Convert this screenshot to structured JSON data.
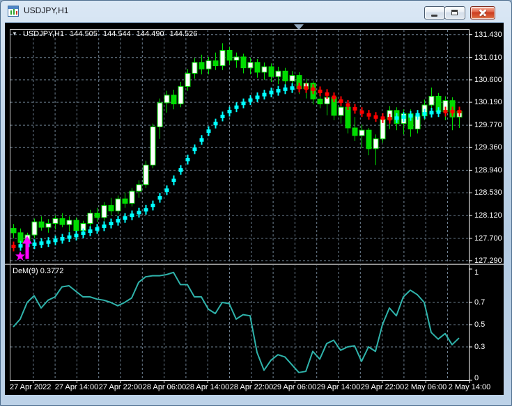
{
  "window": {
    "title": "USDJPY,H1",
    "controls": {
      "minimize": "minimize",
      "restore": "restore",
      "close": "close"
    }
  },
  "chart": {
    "header": {
      "symbol_period": "USDJPY,H1",
      "open": "144.505",
      "high": "144.544",
      "low": "144.490",
      "close": "144.526"
    },
    "price_axis_labels": [
      "131.430",
      "131.010",
      "130.600",
      "130.190",
      "129.770",
      "129.360",
      "128.940",
      "128.530",
      "128.120",
      "127.700",
      "127.290"
    ],
    "time_axis_labels": [
      "27 Apr 2022",
      "27 Apr 14:00",
      "27 Apr 22:00",
      "28 Apr 06:00",
      "28 Apr 14:00",
      "28 Apr 22:00",
      "29 Apr 06:00",
      "29 Apr 14:00",
      "29 Apr 22:00",
      "2 May 06:00",
      "2 May 14:00"
    ],
    "indicator": {
      "label": "DeM(9) 0.3772",
      "name": "DeMarker",
      "axis_labels": [
        "1",
        "0.7",
        "0.5",
        "0.3",
        "0"
      ],
      "levels": [
        0.7,
        0.5,
        0.3
      ]
    },
    "colors": {
      "background": "#000000",
      "grid": "#6e8091",
      "candle": "#00dc00",
      "bull_body": "#ffffff",
      "ma_up": "#00ffff",
      "ma_down": "#ff0000",
      "dem_line": "#2fb3ab",
      "signal": "#ff00ff",
      "axis_text": "#ffffff",
      "border": "#c8c8c8"
    },
    "chart_data": {
      "type": "candlestick",
      "symbol": "USDJPY",
      "period": "H1",
      "price_range": [
        127.29,
        131.43
      ],
      "dem_range": [
        0,
        1
      ],
      "candles": [
        [
          127.88,
          127.96,
          127.7,
          127.8
        ],
        [
          127.8,
          127.88,
          127.52,
          127.62
        ],
        [
          127.62,
          127.8,
          127.44,
          127.76
        ],
        [
          127.76,
          128.06,
          127.7,
          128.0
        ],
        [
          128.0,
          128.1,
          127.84,
          127.9
        ],
        [
          127.9,
          128.05,
          127.8,
          127.97
        ],
        [
          127.97,
          128.12,
          127.86,
          128.06
        ],
        [
          128.06,
          128.16,
          127.9,
          127.95
        ],
        [
          127.95,
          128.1,
          127.82,
          128.03
        ],
        [
          128.03,
          128.08,
          127.72,
          127.84
        ],
        [
          127.84,
          128.02,
          127.72,
          127.97
        ],
        [
          127.97,
          128.22,
          127.9,
          128.16
        ],
        [
          128.16,
          128.26,
          128.0,
          128.08
        ],
        [
          128.08,
          128.36,
          128.02,
          128.3
        ],
        [
          128.3,
          128.44,
          128.12,
          128.2
        ],
        [
          128.2,
          128.48,
          128.14,
          128.42
        ],
        [
          128.42,
          128.54,
          128.26,
          128.34
        ],
        [
          128.34,
          128.62,
          128.28,
          128.56
        ],
        [
          128.56,
          128.76,
          128.44,
          128.68
        ],
        [
          128.68,
          129.12,
          128.62,
          129.04
        ],
        [
          129.04,
          129.8,
          128.98,
          129.74
        ],
        [
          129.74,
          130.26,
          129.52,
          130.18
        ],
        [
          130.18,
          130.4,
          130.0,
          130.32
        ],
        [
          130.32,
          130.42,
          130.06,
          130.16
        ],
        [
          130.16,
          130.56,
          130.1,
          130.48
        ],
        [
          130.48,
          130.8,
          130.4,
          130.72
        ],
        [
          130.72,
          131.0,
          130.62,
          130.92
        ],
        [
          130.92,
          131.06,
          130.7,
          130.8
        ],
        [
          130.8,
          131.02,
          130.7,
          130.95
        ],
        [
          130.95,
          131.1,
          130.78,
          130.86
        ],
        [
          130.86,
          131.27,
          130.78,
          131.14
        ],
        [
          131.14,
          131.2,
          130.88,
          130.96
        ],
        [
          130.96,
          131.1,
          130.82,
          131.02
        ],
        [
          131.02,
          131.08,
          130.72,
          130.82
        ],
        [
          130.82,
          131.0,
          130.7,
          130.92
        ],
        [
          130.92,
          130.98,
          130.64,
          130.74
        ],
        [
          130.74,
          130.92,
          130.6,
          130.84
        ],
        [
          130.84,
          130.9,
          130.56,
          130.66
        ],
        [
          130.66,
          130.84,
          130.52,
          130.76
        ],
        [
          130.76,
          130.82,
          130.48,
          130.58
        ],
        [
          130.58,
          130.76,
          130.4,
          130.68
        ],
        [
          130.68,
          130.74,
          130.34,
          130.44
        ],
        [
          130.44,
          130.62,
          130.26,
          130.54
        ],
        [
          130.54,
          130.58,
          130.15,
          130.25
        ],
        [
          130.25,
          130.45,
          130.08,
          130.16
        ],
        [
          130.16,
          130.35,
          129.95,
          130.28
        ],
        [
          130.28,
          130.32,
          129.86,
          129.95
        ],
        [
          129.95,
          130.18,
          129.8,
          130.1
        ],
        [
          130.1,
          130.14,
          129.62,
          129.72
        ],
        [
          129.72,
          129.92,
          129.48,
          129.58
        ],
        [
          129.58,
          129.78,
          129.35,
          129.68
        ],
        [
          129.68,
          129.72,
          129.22,
          129.34
        ],
        [
          129.34,
          129.6,
          129.04,
          129.52
        ],
        [
          129.52,
          129.95,
          129.45,
          129.88
        ],
        [
          129.88,
          130.12,
          129.7,
          130.04
        ],
        [
          130.04,
          130.1,
          129.68,
          129.8
        ],
        [
          129.8,
          130.06,
          129.6,
          129.98
        ],
        [
          129.98,
          130.06,
          129.56,
          129.7
        ],
        [
          129.7,
          130.02,
          129.62,
          129.94
        ],
        [
          129.94,
          130.24,
          129.86,
          130.14
        ],
        [
          130.14,
          130.46,
          130.04,
          130.3
        ],
        [
          130.3,
          130.36,
          129.92,
          130.02
        ],
        [
          130.02,
          130.3,
          129.86,
          130.22
        ],
        [
          130.22,
          130.28,
          129.68,
          129.92
        ],
        [
          129.92,
          130.1,
          129.72,
          130.02
        ]
      ],
      "ma": {
        "values": [
          127.55,
          127.56,
          127.57,
          127.59,
          127.61,
          127.63,
          127.66,
          127.69,
          127.72,
          127.75,
          127.79,
          127.83,
          127.87,
          127.92,
          127.97,
          128.02,
          128.07,
          128.12,
          128.17,
          128.22,
          128.3,
          128.44,
          128.58,
          128.76,
          128.95,
          129.14,
          129.33,
          129.5,
          129.66,
          129.8,
          129.93,
          130.02,
          130.1,
          130.17,
          130.23,
          130.28,
          130.33,
          130.37,
          130.4,
          130.43,
          130.45,
          130.46,
          130.45,
          130.43,
          130.39,
          130.34,
          130.28,
          130.21,
          130.14,
          130.07,
          130.01,
          129.96,
          129.92,
          129.9,
          129.89,
          129.9,
          129.92,
          129.94,
          129.96,
          129.98,
          130.0,
          130.01,
          130.02,
          130.02,
          130.02
        ],
        "segments": [
          {
            "from": 0,
            "to": 0,
            "dir": "down"
          },
          {
            "from": 1,
            "to": 40,
            "dir": "up"
          },
          {
            "from": 41,
            "to": 54,
            "dir": "down"
          },
          {
            "from": 55,
            "to": 61,
            "dir": "up"
          },
          {
            "from": 62,
            "to": 64,
            "dir": "down"
          }
        ]
      },
      "dem": {
        "values": [
          0.48,
          0.55,
          0.7,
          0.76,
          0.65,
          0.72,
          0.75,
          0.84,
          0.85,
          0.8,
          0.75,
          0.75,
          0.73,
          0.72,
          0.7,
          0.67,
          0.7,
          0.74,
          0.88,
          0.93,
          0.94,
          0.94,
          0.95,
          0.97,
          0.86,
          0.86,
          0.75,
          0.75,
          0.64,
          0.6,
          0.7,
          0.69,
          0.55,
          0.59,
          0.58,
          0.25,
          0.09,
          0.18,
          0.23,
          0.21,
          0.14,
          0.07,
          0.08,
          0.26,
          0.19,
          0.33,
          0.36,
          0.27,
          0.3,
          0.31,
          0.17,
          0.3,
          0.26,
          0.5,
          0.65,
          0.58,
          0.75,
          0.81,
          0.77,
          0.7,
          0.43,
          0.37,
          0.42,
          0.32,
          0.38
        ],
        "last_value": 0.3772
      },
      "signals": [
        {
          "type": "star",
          "bar": 1,
          "price": 127.37
        },
        {
          "type": "buy-arrow",
          "bar": 2,
          "price": 127.32
        }
      ]
    }
  }
}
